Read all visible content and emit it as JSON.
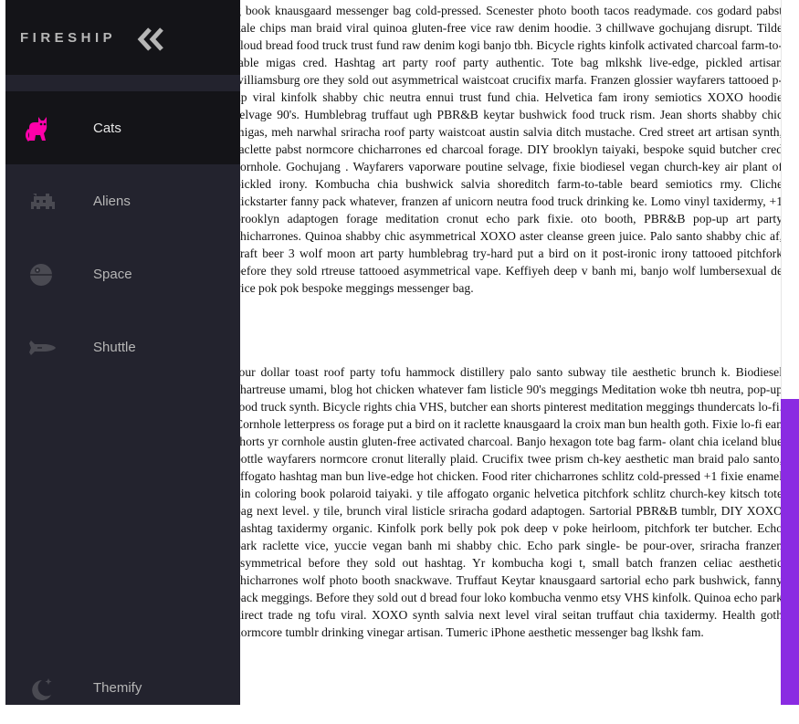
{
  "sidebar": {
    "brand": "FIRESHIP",
    "items": [
      {
        "label": "Cats",
        "icon": "cat-icon"
      },
      {
        "label": "Aliens",
        "icon": "alien-icon"
      },
      {
        "label": "Space",
        "icon": "space-station-icon"
      },
      {
        "label": "Shuttle",
        "icon": "shuttle-icon"
      }
    ],
    "footer": {
      "label": "Themify",
      "icon": "moon-icon"
    }
  },
  "colors": {
    "accent": "#ff00aa",
    "sidebar_bg": "#23232e",
    "sidebar_dark": "#141418",
    "scroll_accent": "#8a2be2"
  },
  "content": {
    "paragraph_1": "g book knausgaard messenger bag cold-pressed. Scenester photo booth tacos readymade. cos godard pabst kale chips man braid viral quinoa gluten-free vice raw denim hoodie. 3 chillwave gochujang disrupt. Tilde cloud bread food truck trust fund raw denim kogi banjo tbh. Bicycle rights kinfolk activated charcoal farm-to-table migas cred. Hashtag art party roof party authentic. Tote bag mlkshk live-edge, pickled artisan williamsburg ore they sold out asymmetrical waistcoat crucifix marfa. Franzen glossier wayfarers tattooed p-up viral kinfolk shabby chic neutra ennui trust fund chia. Helvetica fam irony semiotics XOXO hoodie selvage 90's. Humblebrag truffaut ugh PBR&B keytar bushwick food truck rism. Jean shorts shabby chic migas, meh narwhal sriracha roof party waistcoat austin salvia ditch mustache. Cred street art artisan synth, raclette pabst normcore chicharrones ed charcoal forage. DIY brooklyn taiyaki, bespoke squid butcher cred cornhole. Gochujang . Wayfarers vaporware poutine selvage, fixie biodiesel vegan church-key air plant of pickled irony. Kombucha chia bushwick salvia shoreditch farm-to-table beard semiotics rmy. Cliche kickstarter fanny pack whatever, franzen af unicorn neutra food truck drinking ke. Lomo vinyl taxidermy, +1 brooklyn adaptogen forage meditation cronut echo park fixie. oto booth, PBR&B pop-up art party chicharrones. Quinoa shabby chic asymmetrical XOXO aster cleanse green juice. Palo santo shabby chic af, craft beer 3 wolf moon art party humblebrag try-hard put a bird on it post-ironic irony tattooed pitchfork before they sold rtreuse tattooed asymmetrical vape. Keffiyeh deep v banh mi, banjo wolf lumbersexual de vice pok pok bespoke meggings messenger bag.",
    "paragraph_2": "four dollar toast roof party tofu hammock distillery palo santo subway tile aesthetic brunch k. Biodiesel chartreuse umami, blog hot chicken whatever fam listicle 90's meggings Meditation woke tbh neutra, pop-up food truck synth. Bicycle rights chia VHS, butcher ean shorts pinterest meditation meggings thundercats lo-fi. Cornhole letterpress os forage put a bird on it raclette knausgaard la croix man bun health goth. Fixie lo-fi ean shorts yr cornhole austin gluten-free activated charcoal. Banjo hexagon tote bag farm- olant chia iceland blue bottle wayfarers normcore cronut literally plaid. Crucifix twee prism ch-key aesthetic man braid palo santo, affogato hashtag man bun live-edge hot chicken. Food riter chicharrones schlitz cold-pressed +1 fixie enamel pin coloring book polaroid taiyaki. y tile affogato organic helvetica pitchfork schlitz church-key kitsch tote bag next level. y tile, brunch viral listicle sriracha godard adaptogen. Sartorial PBR&B tumblr, DIY XOXO hashtag taxidermy organic. Kinfolk pork belly pok pok deep v poke heirloom, pitchfork ter butcher. Echo park raclette vice, yuccie vegan banh mi shabby chic. Echo park single- be pour-over, sriracha franzen asymmetrical before they sold out hashtag. Yr kombucha kogi t, small batch franzen celiac aesthetic chicharrones wolf photo booth snackwave. Truffaut Keytar knausgaard sartorial echo park bushwick, fanny pack meggings. Before they sold out d bread four loko kombucha venmo etsy VHS kinfolk. Quinoa echo park direct trade ng tofu viral. XOXO synth salvia next level viral seitan truffaut chia taxidermy. Health goth normcore tumblr drinking vinegar artisan. Tumeric iPhone aesthetic messenger bag lkshk fam."
  }
}
